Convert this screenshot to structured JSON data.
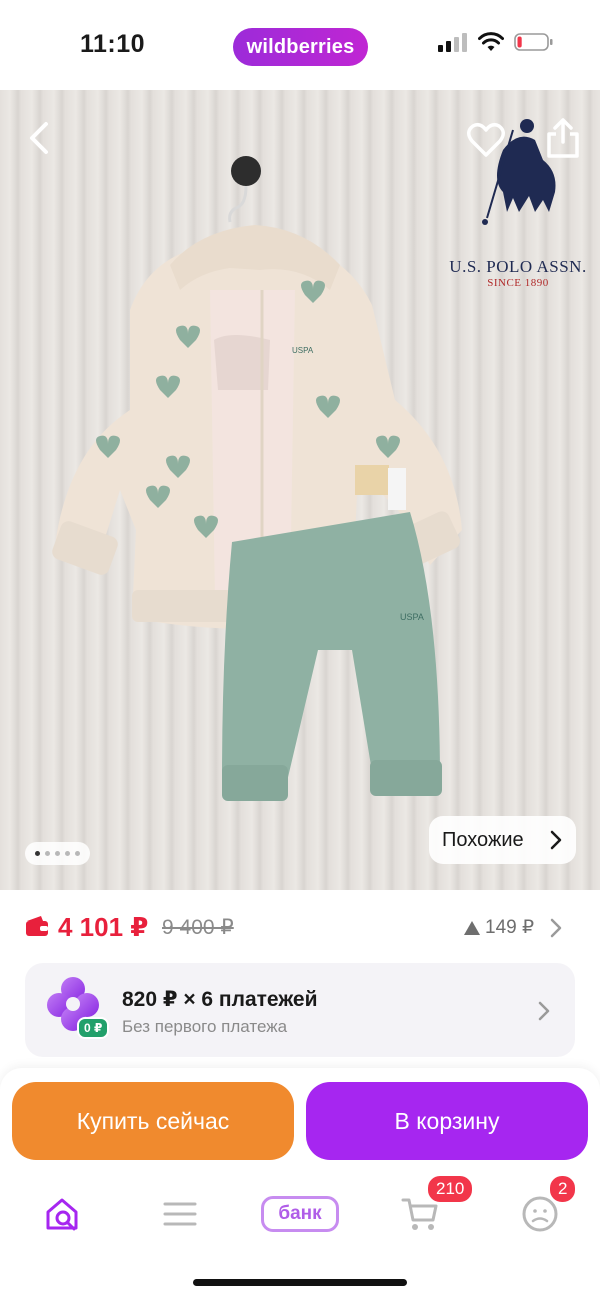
{
  "status_bar": {
    "time": "11:10",
    "brand": "wildberries",
    "battery_level": 0.15
  },
  "hero": {
    "logo": {
      "name": "U.S. POLO ASSN.",
      "since": "SINCE 1890"
    },
    "print_text": "USPA",
    "gallery": {
      "count": 5,
      "active_index": 0
    },
    "similar_label": "Похожие"
  },
  "price": {
    "current": "4 101 ₽",
    "old": "9 400 ₽",
    "delta": "149 ₽"
  },
  "installment": {
    "title": "820 ₽ × 6 платежей",
    "subtitle": "Без первого платежа",
    "badge": "0 ₽"
  },
  "actions": {
    "buy_now": "Купить сейчас",
    "add_to_cart": "В корзину"
  },
  "tab_bar": {
    "bank_label": "банк",
    "cart_badge": "210",
    "profile_badge": "2"
  },
  "colors": {
    "brand_purple": "#a626f0",
    "buy_orange": "#f08a2e",
    "price_red": "#e8203c",
    "badge_red": "#f2364a",
    "zero_badge_green": "#22a06b"
  },
  "icons": [
    "back-icon",
    "heart-icon",
    "share-icon",
    "wallet-icon",
    "triangle-up-icon",
    "chevron-right-icon",
    "installment-flower-icon",
    "home-search-icon",
    "menu-icon",
    "cart-icon",
    "profile-icon",
    "signal-icon",
    "wifi-icon",
    "battery-icon"
  ]
}
